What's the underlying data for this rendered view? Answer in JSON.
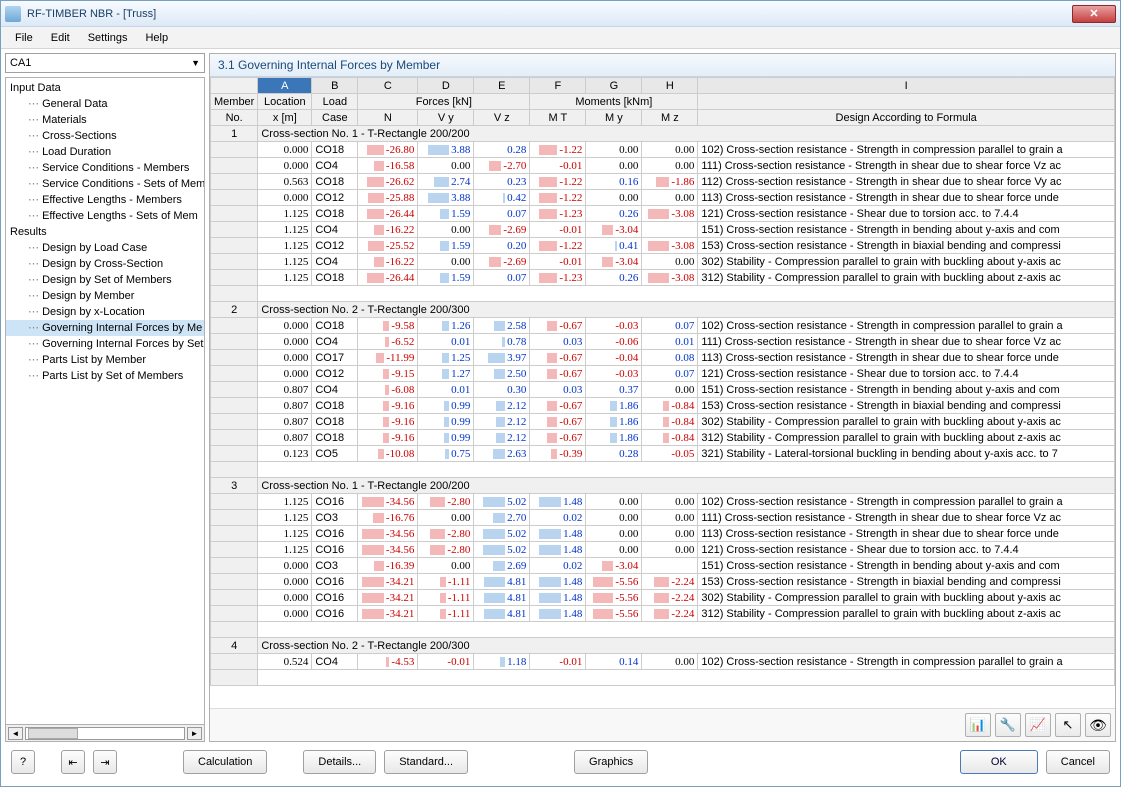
{
  "window": {
    "title": "RF-TIMBER NBR - [Truss]"
  },
  "menu": [
    "File",
    "Edit",
    "Settings",
    "Help"
  ],
  "combo": "CA1",
  "tree": {
    "groups": [
      {
        "label": "Input Data",
        "items": [
          "General Data",
          "Materials",
          "Cross-Sections",
          "Load Duration",
          "Service Conditions - Members",
          "Service Conditions - Sets of Mem",
          "Effective Lengths - Members",
          "Effective Lengths - Sets of Mem"
        ]
      },
      {
        "label": "Results",
        "items": [
          "Design by Load Case",
          "Design by Cross-Section",
          "Design by Set of Members",
          "Design by Member",
          "Design by x-Location",
          "Governing Internal Forces by Me",
          "Governing Internal Forces by Set",
          "Parts List by Member",
          "Parts List by Set of Members"
        ]
      }
    ],
    "selected": "Governing Internal Forces by Me"
  },
  "panel_title": "3.1  Governing Internal Forces by Member",
  "col_letters": [
    "A",
    "B",
    "C",
    "D",
    "E",
    "F",
    "G",
    "H",
    "I"
  ],
  "header_row1": {
    "member": "Member",
    "location": "Location",
    "load": "Load",
    "forces": "Forces [kN]",
    "moments": "Moments [kNm]",
    "design": ""
  },
  "header_row2": {
    "no": "No.",
    "x": "x [m]",
    "case": "Case",
    "N": "N",
    "Vy": "V y",
    "Vz": "V z",
    "MT": "M T",
    "My": "M y",
    "Mz": "M z",
    "design": "Design According to Formula"
  },
  "groups": [
    {
      "member": "1",
      "section": "Cross-section No. 1 - T-Rectangle 200/200",
      "rows": [
        {
          "x": "0.000",
          "lc": "CO18",
          "N": "-26.80",
          "Vy": "3.88",
          "Vz": "0.28",
          "MT": "-1.22",
          "My": "0.00",
          "Mz": "0.00",
          "d": "102) Cross-section resistance - Strength in compression parallel to grain a"
        },
        {
          "x": "0.000",
          "lc": "CO4",
          "N": "-16.58",
          "Vy": "0.00",
          "Vz": "-2.70",
          "MT": "-0.01",
          "My": "0.00",
          "Mz": "0.00",
          "d": "111) Cross-section resistance - Strength in shear due to shear force Vz ac"
        },
        {
          "x": "0.563",
          "lc": "CO18",
          "N": "-26.62",
          "Vy": "2.74",
          "Vz": "0.23",
          "MT": "-1.22",
          "My": "0.16",
          "Mz": "-1.86",
          "d": "112) Cross-section resistance - Strength in shear due to shear force Vy ac"
        },
        {
          "x": "0.000",
          "lc": "CO12",
          "N": "-25.88",
          "Vy": "3.88",
          "Vz": "0.42",
          "MT": "-1.22",
          "My": "0.00",
          "Mz": "0.00",
          "d": "113) Cross-section resistance - Strength in shear due to shear force unde"
        },
        {
          "x": "1.125",
          "lc": "CO18",
          "N": "-26.44",
          "Vy": "1.59",
          "Vz": "0.07",
          "MT": "-1.23",
          "My": "0.26",
          "Mz": "-3.08",
          "d": "121) Cross-section resistance - Shear due to torsion acc. to 7.4.4"
        },
        {
          "x": "1.125",
          "lc": "CO4",
          "N": "-16.22",
          "Vy": "0.00",
          "Vz": "-2.69",
          "MT": "-0.01",
          "My": "-3.04",
          "Mz": "",
          "d": "151) Cross-section resistance - Strength in bending about y-axis and com"
        },
        {
          "x": "1.125",
          "lc": "CO12",
          "N": "-25.52",
          "Vy": "1.59",
          "Vz": "0.20",
          "MT": "-1.22",
          "My": "0.41",
          "Mz": "-3.08",
          "d": "153) Cross-section resistance - Strength in biaxial bending and compressi"
        },
        {
          "x": "1.125",
          "lc": "CO4",
          "N": "-16.22",
          "Vy": "0.00",
          "Vz": "-2.69",
          "MT": "-0.01",
          "My": "-3.04",
          "Mz": "0.00",
          "d": "302) Stability - Compression parallel to grain with buckling about y-axis ac"
        },
        {
          "x": "1.125",
          "lc": "CO18",
          "N": "-26.44",
          "Vy": "1.59",
          "Vz": "0.07",
          "MT": "-1.23",
          "My": "0.26",
          "Mz": "-3.08",
          "d": "312) Stability - Compression parallel to grain with buckling about z-axis ac"
        }
      ]
    },
    {
      "member": "2",
      "section": "Cross-section No. 2 - T-Rectangle 200/300",
      "rows": [
        {
          "x": "0.000",
          "lc": "CO18",
          "N": "-9.58",
          "Vy": "1.26",
          "Vz": "2.58",
          "MT": "-0.67",
          "My": "-0.03",
          "Mz": "0.07",
          "d": "102) Cross-section resistance - Strength in compression parallel to grain a"
        },
        {
          "x": "0.000",
          "lc": "CO4",
          "N": "-6.52",
          "Vy": "0.01",
          "Vz": "0.78",
          "MT": "0.03",
          "My": "-0.06",
          "Mz": "0.01",
          "d": "111) Cross-section resistance - Strength in shear due to shear force Vz ac"
        },
        {
          "x": "0.000",
          "lc": "CO17",
          "N": "-11.99",
          "Vy": "1.25",
          "Vz": "3.97",
          "MT": "-0.67",
          "My": "-0.04",
          "Mz": "0.08",
          "d": "113) Cross-section resistance - Strength in shear due to shear force unde"
        },
        {
          "x": "0.000",
          "lc": "CO12",
          "N": "-9.15",
          "Vy": "1.27",
          "Vz": "2.50",
          "MT": "-0.67",
          "My": "-0.03",
          "Mz": "0.07",
          "d": "121) Cross-section resistance - Shear due to torsion acc. to 7.4.4"
        },
        {
          "x": "0.807",
          "lc": "CO4",
          "N": "-6.08",
          "Vy": "0.01",
          "Vz": "0.30",
          "MT": "0.03",
          "My": "0.37",
          "Mz": "0.00",
          "d": "151) Cross-section resistance - Strength in bending about y-axis and com"
        },
        {
          "x": "0.807",
          "lc": "CO18",
          "N": "-9.16",
          "Vy": "0.99",
          "Vz": "2.12",
          "MT": "-0.67",
          "My": "1.86",
          "Mz": "-0.84",
          "d": "153) Cross-section resistance - Strength in biaxial bending and compressi"
        },
        {
          "x": "0.807",
          "lc": "CO18",
          "N": "-9.16",
          "Vy": "0.99",
          "Vz": "2.12",
          "MT": "-0.67",
          "My": "1.86",
          "Mz": "-0.84",
          "d": "302) Stability - Compression parallel to grain with buckling about y-axis ac"
        },
        {
          "x": "0.807",
          "lc": "CO18",
          "N": "-9.16",
          "Vy": "0.99",
          "Vz": "2.12",
          "MT": "-0.67",
          "My": "1.86",
          "Mz": "-0.84",
          "d": "312) Stability - Compression parallel to grain with buckling about z-axis ac"
        },
        {
          "x": "0.123",
          "lc": "CO5",
          "N": "-10.08",
          "Vy": "0.75",
          "Vz": "2.63",
          "MT": "-0.39",
          "My": "0.28",
          "Mz": "-0.05",
          "d": "321) Stability - Lateral-torsional buckling in bending about y-axis acc. to 7"
        }
      ]
    },
    {
      "member": "3",
      "section": "Cross-section No. 1 - T-Rectangle 200/200",
      "rows": [
        {
          "x": "1.125",
          "lc": "CO16",
          "N": "-34.56",
          "Vy": "-2.80",
          "Vz": "5.02",
          "MT": "1.48",
          "My": "0.00",
          "Mz": "0.00",
          "d": "102) Cross-section resistance - Strength in compression parallel to grain a"
        },
        {
          "x": "1.125",
          "lc": "CO3",
          "N": "-16.76",
          "Vy": "0.00",
          "Vz": "2.70",
          "MT": "0.02",
          "My": "0.00",
          "Mz": "0.00",
          "d": "111) Cross-section resistance - Strength in shear due to shear force Vz ac"
        },
        {
          "x": "1.125",
          "lc": "CO16",
          "N": "-34.56",
          "Vy": "-2.80",
          "Vz": "5.02",
          "MT": "1.48",
          "My": "0.00",
          "Mz": "0.00",
          "d": "113) Cross-section resistance - Strength in shear due to shear force unde"
        },
        {
          "x": "1.125",
          "lc": "CO16",
          "N": "-34.56",
          "Vy": "-2.80",
          "Vz": "5.02",
          "MT": "1.48",
          "My": "0.00",
          "Mz": "0.00",
          "d": "121) Cross-section resistance - Shear due to torsion acc. to 7.4.4"
        },
        {
          "x": "0.000",
          "lc": "CO3",
          "N": "-16.39",
          "Vy": "0.00",
          "Vz": "2.69",
          "MT": "0.02",
          "My": "-3.04",
          "Mz": "",
          "d": "151) Cross-section resistance - Strength in bending about y-axis and com"
        },
        {
          "x": "0.000",
          "lc": "CO16",
          "N": "-34.21",
          "Vy": "-1.11",
          "Vz": "4.81",
          "MT": "1.48",
          "My": "-5.56",
          "Mz": "-2.24",
          "d": "153) Cross-section resistance - Strength in biaxial bending and compressi"
        },
        {
          "x": "0.000",
          "lc": "CO16",
          "N": "-34.21",
          "Vy": "-1.11",
          "Vz": "4.81",
          "MT": "1.48",
          "My": "-5.56",
          "Mz": "-2.24",
          "d": "302) Stability - Compression parallel to grain with buckling about y-axis ac"
        },
        {
          "x": "0.000",
          "lc": "CO16",
          "N": "-34.21",
          "Vy": "-1.11",
          "Vz": "4.81",
          "MT": "1.48",
          "My": "-5.56",
          "Mz": "-2.24",
          "d": "312) Stability - Compression parallel to grain with buckling about z-axis ac"
        }
      ]
    },
    {
      "member": "4",
      "section": "Cross-section No. 2 - T-Rectangle 200/300",
      "rows": [
        {
          "x": "0.524",
          "lc": "CO4",
          "N": "-4.53",
          "Vy": "-0.01",
          "Vz": "1.18",
          "MT": "-0.01",
          "My": "0.14",
          "Mz": "0.00",
          "d": "102) Cross-section resistance - Strength in compression parallel to grain a"
        }
      ]
    }
  ],
  "buttons": {
    "calculation": "Calculation",
    "details": "Details...",
    "standard": "Standard...",
    "graphics": "Graphics",
    "ok": "OK",
    "cancel": "Cancel"
  }
}
